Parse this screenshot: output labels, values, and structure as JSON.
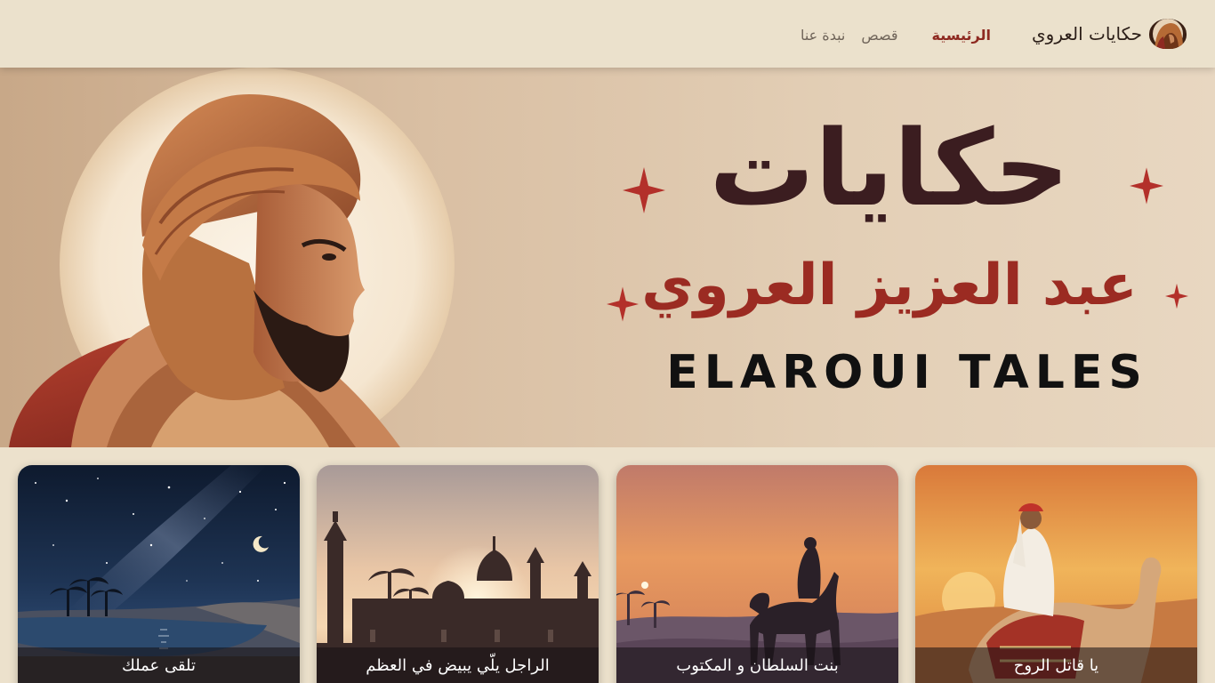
{
  "brand": {
    "name": "حكايات العروي",
    "logo_icon": "storyteller-avatar-icon"
  },
  "nav": {
    "items": [
      {
        "label": "الرئيسية",
        "active": true
      },
      {
        "label": "قصص",
        "active": false
      },
      {
        "label": "نبدة عنا",
        "active": false
      }
    ]
  },
  "hero": {
    "title": "حكايات",
    "subtitle": "عبد العزيز العروي",
    "latin_title": "ELAROUI TALES",
    "colors": {
      "title": "#3b1d20",
      "subtitle": "#9b2b22",
      "sparkle": "#b3302a"
    }
  },
  "stories": [
    {
      "title": "يا قاتل الروح",
      "image": "camel-rider-sunset"
    },
    {
      "title": "بنت السلطان و المكتوب",
      "image": "camel-desert-dusk"
    },
    {
      "title": "الراجل يلّي يبيض في العظم",
      "image": "mosque-palms-sunset"
    },
    {
      "title": "تلقى عملك",
      "image": "oasis-night-sky"
    }
  ]
}
